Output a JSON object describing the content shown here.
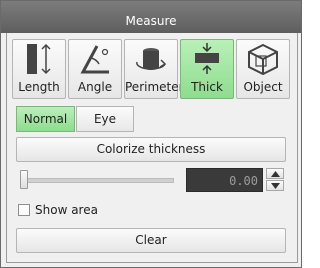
{
  "window": {
    "title": "Measure"
  },
  "tools": [
    {
      "label": "Length",
      "icon": "length-icon",
      "active": false
    },
    {
      "label": "Angle",
      "icon": "angle-icon",
      "active": false
    },
    {
      "label": "Perimeter",
      "icon": "perimeter-icon",
      "active": false
    },
    {
      "label": "Thick",
      "icon": "thickness-icon",
      "active": true
    },
    {
      "label": "Object",
      "icon": "object-icon",
      "active": false
    }
  ],
  "modes": [
    {
      "label": "Normal",
      "active": true
    },
    {
      "label": "Eye",
      "active": false
    }
  ],
  "colorize_button": "Colorize thickness",
  "slider": {
    "value_text": "0.00",
    "level": 0
  },
  "show_area": {
    "label": "Show area",
    "checked": false
  },
  "clear_button": "Clear",
  "colors": {
    "active": "#8fdc8f",
    "titlebar": "#6a6a6a",
    "field": "#3a3a3a"
  }
}
